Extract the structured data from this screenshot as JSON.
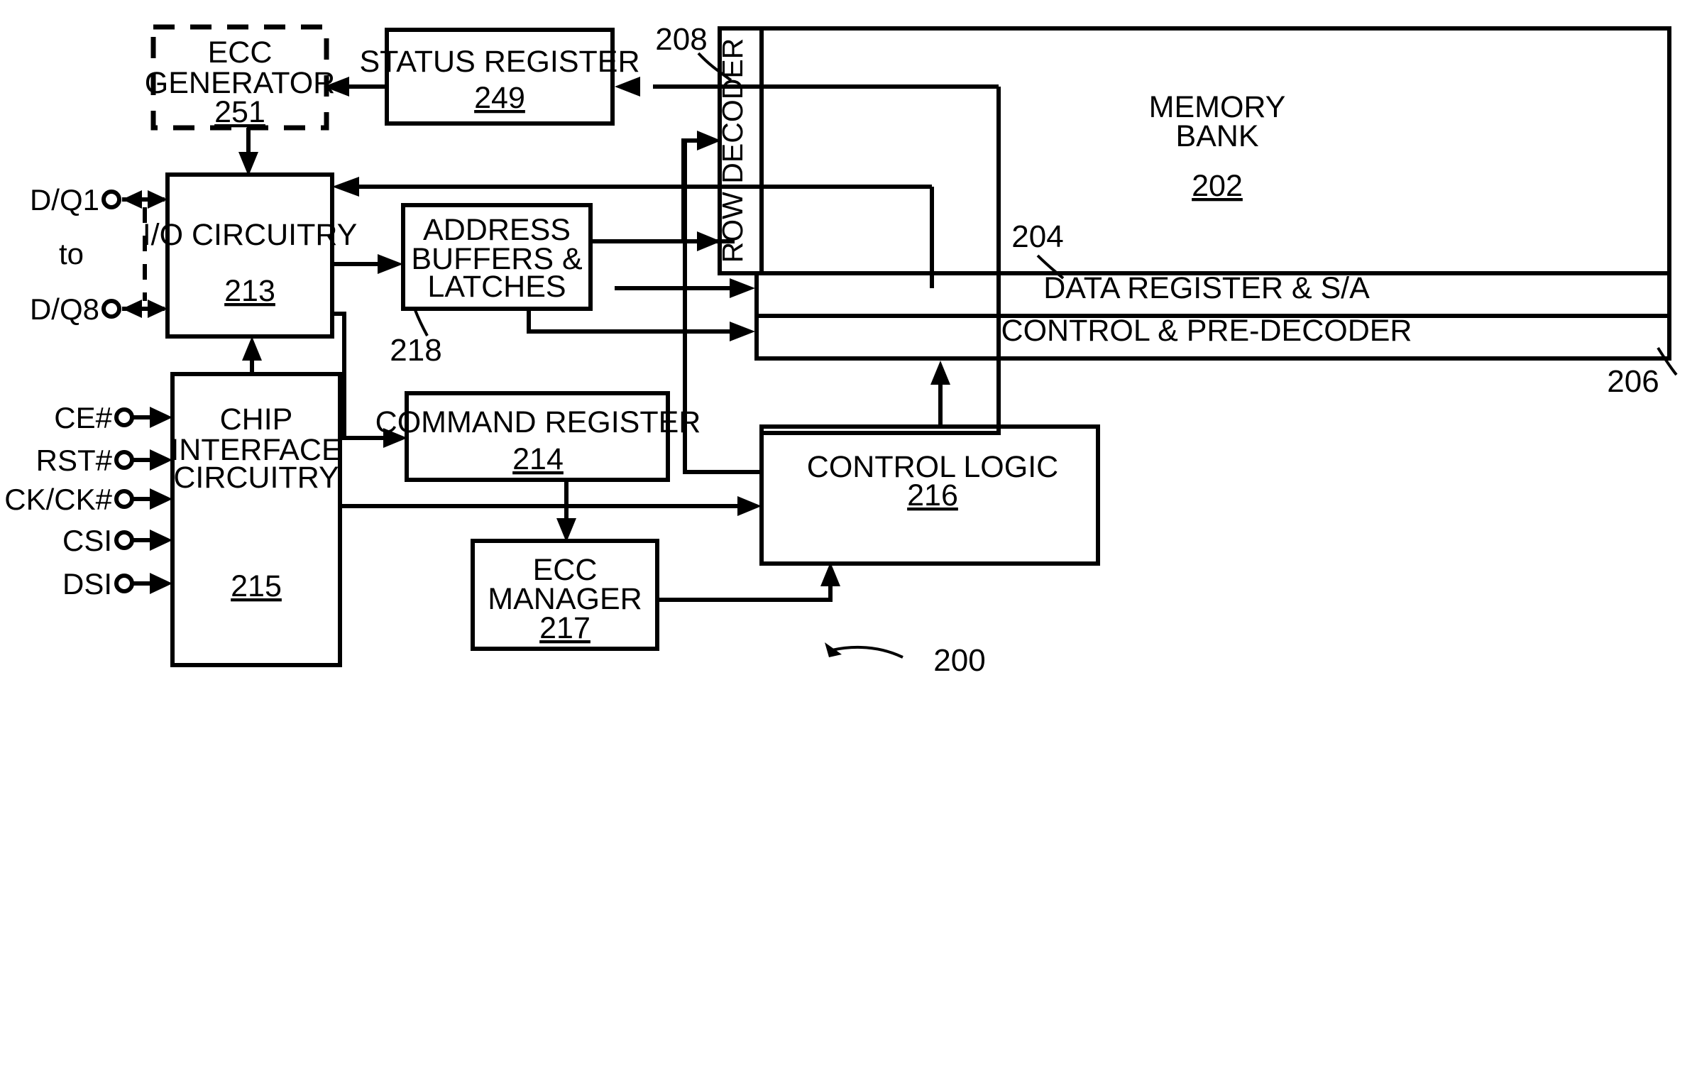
{
  "figure": {
    "reference_numeral": "200"
  },
  "blocks": {
    "ecc_generator": {
      "line1": "ECC",
      "line2": "GENERATOR",
      "ref": "251"
    },
    "status_register": {
      "line1": "STATUS REGISTER",
      "ref": "249"
    },
    "io_circuitry": {
      "line1": "I/O CIRCUITRY",
      "ref": "213"
    },
    "address_buffers": {
      "line1": "ADDRESS",
      "line2": "BUFFERS &",
      "line3": "LATCHES",
      "ref": "218"
    },
    "chip_interface": {
      "line1": "CHIP",
      "line2": "INTERFACE",
      "line3": "CIRCUITRY",
      "ref": "215"
    },
    "command_register": {
      "line1": "COMMAND REGISTER",
      "ref": "214"
    },
    "ecc_manager": {
      "line1": "ECC",
      "line2": "MANAGER",
      "ref": "217"
    },
    "control_logic": {
      "line1": "CONTROL LOGIC",
      "ref": "216"
    },
    "memory_bank": {
      "line1": "MEMORY",
      "line2": "BANK",
      "ref": "202"
    },
    "row_decoder": {
      "line1": "ROW DECODER",
      "ref": "208"
    },
    "data_register": {
      "line1": "DATA REGISTER & S/A",
      "ref": "204"
    },
    "control_predecoder": {
      "line1": "CONTROL & PRE-DECODER",
      "ref": "206"
    }
  },
  "pins": {
    "data": [
      {
        "label": "D/Q1"
      },
      {
        "label": "to"
      },
      {
        "label": "D/Q8"
      }
    ],
    "control": [
      {
        "label": "CE#"
      },
      {
        "label": "RST#"
      },
      {
        "label": "CK/CK#"
      },
      {
        "label": "CSI"
      },
      {
        "label": "DSI"
      }
    ]
  },
  "colors": {
    "line": "#000000",
    "background": "#ffffff"
  }
}
